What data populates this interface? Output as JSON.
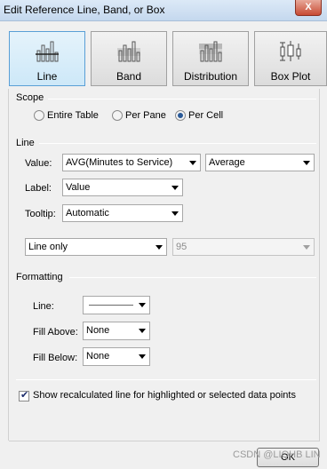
{
  "window": {
    "title": "Edit Reference Line, Band, or Box",
    "close_label": "X"
  },
  "tabs": [
    {
      "label": "Line",
      "selected": true
    },
    {
      "label": "Band",
      "selected": false
    },
    {
      "label": "Distribution",
      "selected": false
    },
    {
      "label": "Box Plot",
      "selected": false
    }
  ],
  "scope": {
    "heading": "Scope",
    "options": [
      {
        "label": "Entire Table",
        "selected": false
      },
      {
        "label": "Per Pane",
        "selected": false
      },
      {
        "label": "Per Cell",
        "selected": true
      }
    ]
  },
  "line": {
    "heading": "Line",
    "value_label": "Value:",
    "value_field": "AVG(Minutes to Service)",
    "aggregation": "Average",
    "label_label": "Label:",
    "label_value": "Value",
    "tooltip_label": "Tooltip:",
    "tooltip_value": "Automatic",
    "line_type": "Line only",
    "confidence": "95"
  },
  "formatting": {
    "heading": "Formatting",
    "line_label": "Line:",
    "fill_above_label": "Fill Above:",
    "fill_above_value": "None",
    "fill_below_label": "Fill Below:",
    "fill_below_value": "None"
  },
  "options": {
    "recalc_label": "Show recalculated line for highlighted or selected data points",
    "recalc_checked": true
  },
  "footer": {
    "ok_label": "OK",
    "watermark": "CSDN @LIQHB LIN"
  },
  "colors": {
    "selected_tab": "#cde8f8",
    "accent": "#2a5a98",
    "close": "#c74a33"
  }
}
